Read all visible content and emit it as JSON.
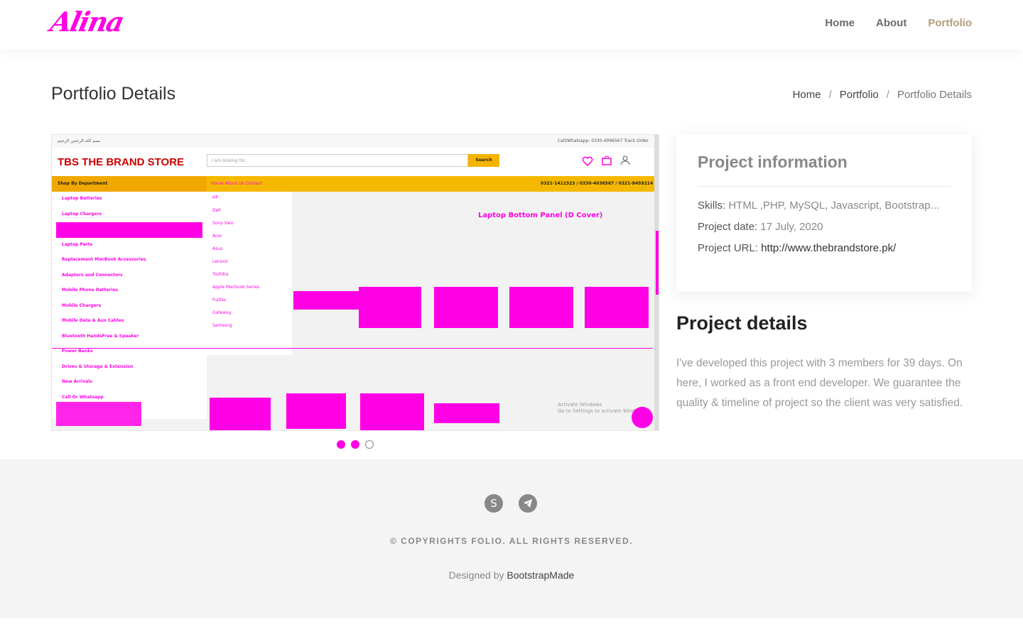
{
  "brand": {
    "logo_text": "Alina",
    "accent_color": "#ff00e6"
  },
  "nav": {
    "items": [
      "Home",
      "About",
      "Portfolio"
    ],
    "active": "Portfolio"
  },
  "page": {
    "title": "Portfolio Details"
  },
  "breadcrumb": {
    "items": [
      "Home",
      "Portfolio",
      "Portfolio Details"
    ]
  },
  "slider": {
    "image_alt": "The Brand Store website screenshot",
    "inner": {
      "top_left": "بسم الله الرحمن الرحيم",
      "top_right": "Call/Whatsapp: 0330-4096567   Track Order",
      "logo": "TBS THE BRAND STORE",
      "search_placeholder": "I am looking for...",
      "search_button": "Search",
      "department": "Shop By Department",
      "links": "Home   About Us   Contact",
      "phones": "0321-1412323 / 0330-4036567 / 0321-8459214",
      "product_title": "Laptop Bottom Panel (D Cover)",
      "menu": [
        "Laptop Batteries",
        "Laptop Chargers",
        "",
        "Laptop Parts",
        "Replacement MacBook Accessories",
        "Adapters and Connectors",
        "Mobile Phone Batteries",
        "Mobile Chargers",
        "Mobile Data & Aux Cables",
        "Bluetooth HandsFree & Speaker",
        "Power Banks",
        "Drives & Storage & Extension",
        "New Arrivals",
        "Call Or Whatsapp"
      ],
      "submenu": [
        "HP",
        "Dell",
        "Sony Vaio",
        "Acer",
        "Asus",
        "Lenovo",
        "Toshiba",
        "Apple Macbook Series",
        "Fujitsu",
        "Gateway",
        "Samsung"
      ],
      "watermark_line1": "Activate Windows",
      "watermark_line2": "Go to Settings to activate Windows."
    },
    "dots": [
      true,
      true,
      false
    ]
  },
  "project_info": {
    "title": "Project information",
    "skills_label": "Skills:",
    "skills_value": " HTML ,PHP, MySQL, Javascript, Bootstrap...",
    "date_label": "Project date:",
    "date_value": " 17 July, 2020",
    "url_label": "Project URL:",
    "url_value": "http://www.thebrandstore.pk/"
  },
  "project_details": {
    "title": "Project details",
    "text": "I've developed this project with 3 members for 39 days. On here, I worked as a front end developer. We guarantee the quality & timeline of project so the client was very satisfied."
  },
  "footer": {
    "social_icons": [
      "skype-icon",
      "telegram-icon"
    ],
    "copyright": "© COPYRIGHTS FOLIO. ALL RIGHTS RESERVED.",
    "credits_prefix": "Designed by ",
    "credits_link": "BootstrapMade"
  }
}
